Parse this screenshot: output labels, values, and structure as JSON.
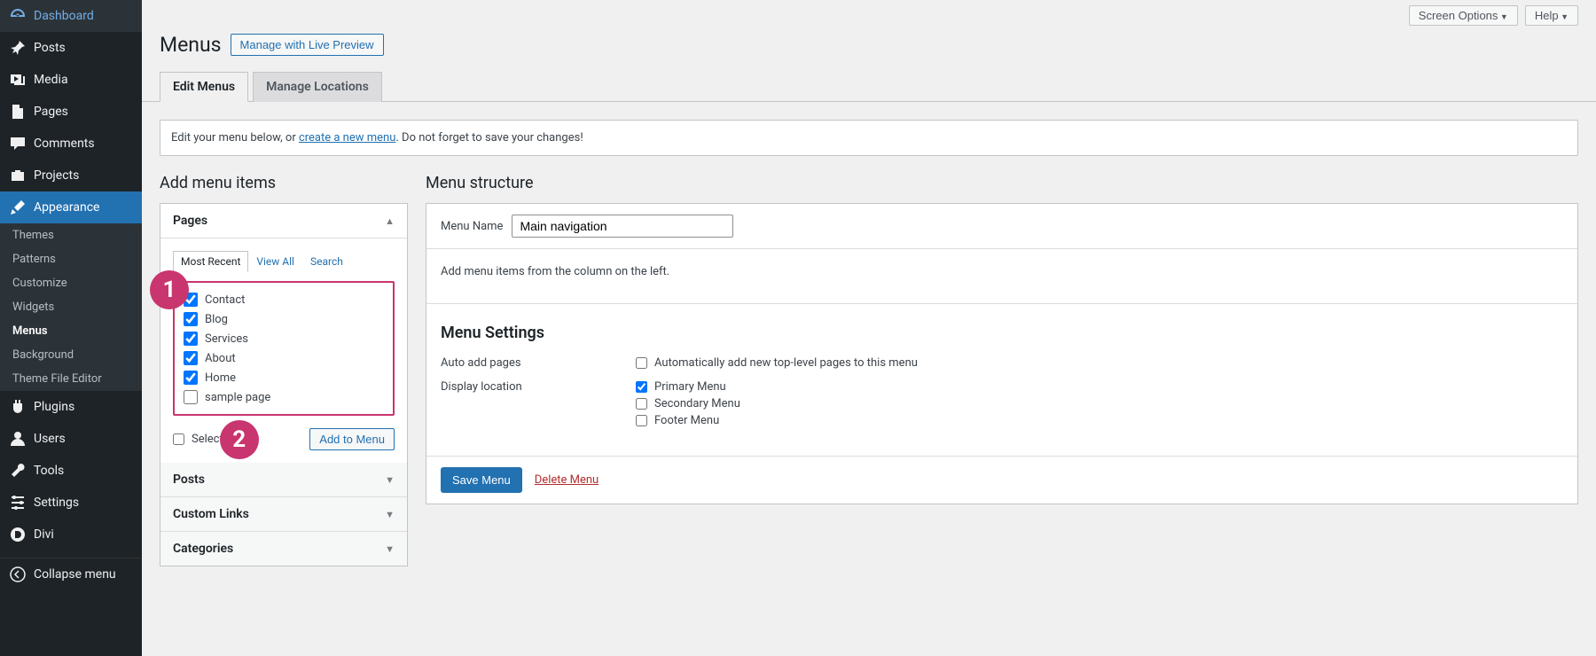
{
  "topbar": {
    "screen_options": "Screen Options",
    "help": "Help"
  },
  "sidebar": {
    "items": [
      {
        "label": "Dashboard"
      },
      {
        "label": "Posts"
      },
      {
        "label": "Media"
      },
      {
        "label": "Pages"
      },
      {
        "label": "Comments"
      },
      {
        "label": "Projects"
      },
      {
        "label": "Appearance"
      },
      {
        "label": "Plugins"
      },
      {
        "label": "Users"
      },
      {
        "label": "Tools"
      },
      {
        "label": "Settings"
      },
      {
        "label": "Divi"
      }
    ],
    "appearance_sub": [
      "Themes",
      "Patterns",
      "Customize",
      "Widgets",
      "Menus",
      "Background",
      "Theme File Editor"
    ],
    "collapse": "Collapse menu"
  },
  "header": {
    "title": "Menus",
    "live_preview": "Manage with Live Preview"
  },
  "tabs": {
    "edit": "Edit Menus",
    "locations": "Manage Locations"
  },
  "notice": {
    "pre": "Edit your menu below, or ",
    "link": "create a new menu",
    "post": ". Do not forget to save your changes!"
  },
  "left": {
    "heading": "Add menu items",
    "acc": {
      "pages": "Pages",
      "posts": "Posts",
      "custom_links": "Custom Links",
      "categories": "Categories"
    },
    "sub_tabs": {
      "recent": "Most Recent",
      "view_all": "View All",
      "search": "Search"
    },
    "page_items": [
      "Contact",
      "Blog",
      "Services",
      "About",
      "Home",
      "sample page"
    ],
    "page_checked": [
      true,
      true,
      true,
      true,
      true,
      false
    ],
    "select_all": "Select All",
    "add_to_menu": "Add to Menu"
  },
  "callouts": {
    "one": "1",
    "two": "2"
  },
  "right": {
    "heading": "Menu structure",
    "name_label": "Menu Name",
    "name_value": "Main navigation",
    "body_text": "Add menu items from the column on the left.",
    "settings_title": "Menu Settings",
    "auto_add_label": "Auto add pages",
    "auto_add_opt": "Automatically add new top-level pages to this menu",
    "display_loc_label": "Display location",
    "loc_opts": [
      "Primary Menu",
      "Secondary Menu",
      "Footer Menu"
    ],
    "loc_checked": [
      true,
      false,
      false
    ],
    "save": "Save Menu",
    "delete": "Delete Menu"
  }
}
